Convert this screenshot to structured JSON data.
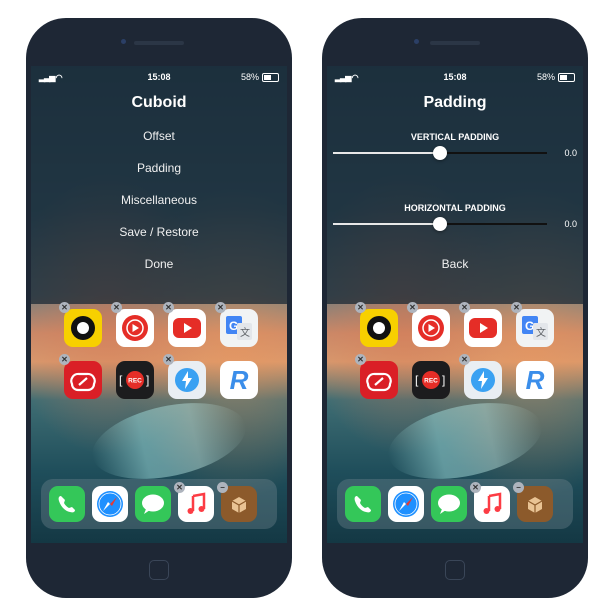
{
  "status": {
    "time": "15:08",
    "battery": "58%"
  },
  "left_menu": {
    "title": "Cuboid",
    "items": [
      "Offset",
      "Padding",
      "Miscellaneous",
      "Save / Restore",
      "Done"
    ]
  },
  "right_menu": {
    "title": "Padding",
    "vertical": {
      "label": "VERTICAL PADDING",
      "value": "0.0",
      "level": 0.5
    },
    "horizontal": {
      "label": "HORIZONTAL PADDING",
      "value": "0.0",
      "level": 0.5
    },
    "back_label": "Back"
  },
  "apps": {
    "row1": [
      "black-ring-app-icon",
      "youtube-music-icon",
      "youtube-icon",
      "google-translate-icon"
    ],
    "row2": [
      "creative-cloud-icon",
      "screen-recorder-icon",
      "shortcut-flash-icon",
      "reeder-icon"
    ],
    "rec_label": "REC",
    "reeder_letter": "R"
  },
  "dock": [
    "phone-icon",
    "safari-icon",
    "messages-icon",
    "music-icon",
    "cydia-icon"
  ],
  "colors": {
    "menu_bg": "#16263a",
    "slider_fill": "#e8e8e8",
    "youtube_red": "#e52d27",
    "adobe_red": "#da1f26"
  }
}
